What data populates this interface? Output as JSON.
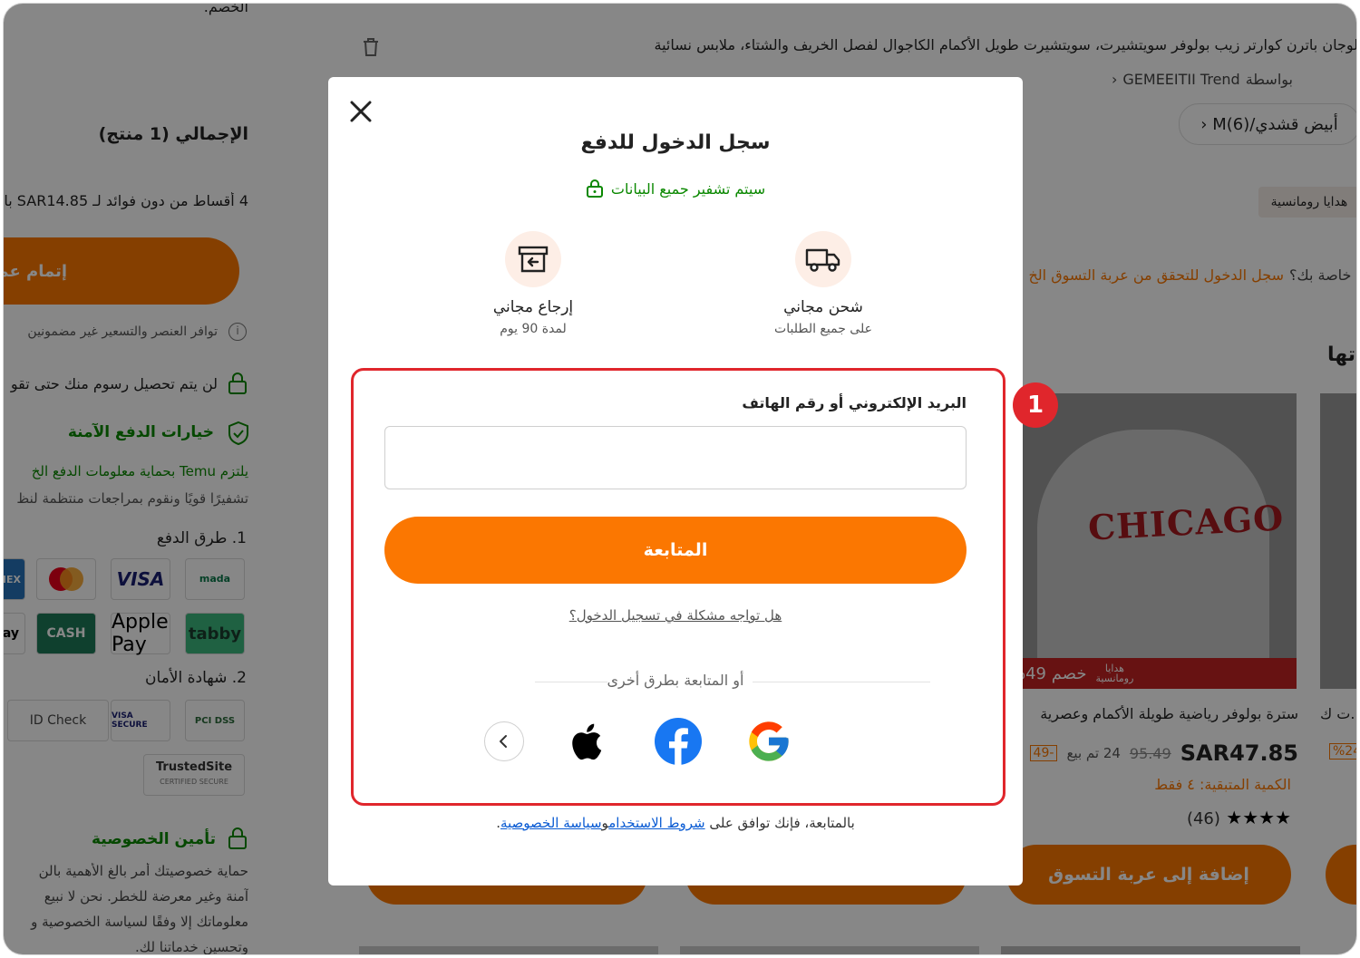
{
  "background": {
    "left_column": {
      "top_text": "الخصم.",
      "total_label": "الإجمالي (1 منتج)",
      "installments": "4 أقساط من دون فوائد لـ SAR14.85 با",
      "checkout_button": "إتمام عم",
      "availability_note": "توافر العنصر والتسعير غير مضمونين",
      "no_fees_note": "لن يتم تحصيل رسوم منك حتى تقو",
      "safe_payment_title": "خيارات الدفع الآمنة",
      "safe_payment_line1": "يلتزم Temu بحماية معلومات الدفع الخ",
      "safe_payment_line2": "تشفيرًا قويًا ونقوم بمراجعات منتظمة لنظ",
      "payment_methods_label": "1. طرق الدفع",
      "payment_methods": [
        "mada",
        "VISA",
        "mastercard",
        "AMEX",
        "tabby",
        "Apple Pay",
        "CASH",
        "Pay"
      ],
      "security_cert_label": "2. شهادة الأمان",
      "security_certs": [
        "PCI DSS",
        "VISA SECURE",
        "ID Check",
        "TrustedSite",
        "CERTIFIED SECURE"
      ],
      "privacy_title": "تأمين الخصوصية",
      "privacy_line1": "حماية خصوصيتك أمر بالغ الأهمية بالن",
      "privacy_line2": "آمنة وغير معرضة للخطر. نحن لا نبيع",
      "privacy_line3": "معلوماتك إلا وفقًا لسياسة الخصوصية و",
      "privacy_line4": "وتحسين خدماتنا لك."
    },
    "product": {
      "title": "لوجان باترن كوارتر زيب بولوفر سويتشيرت، سويتشيرت طويل الأكمام الكاجوال لفصل الخريف والشتاء، ملابس نسائية",
      "seller_prefix": "بواسطة",
      "seller": "GEMEEITII Trend",
      "variant": "أبيض قشدي/M(6)",
      "tag": "هدايا رومانسية",
      "signin_prompt": "سجل الدخول للتحقق من عربة التسوق الخ",
      "signin_prefix": "خاصة بك؟",
      "section_title": "تها"
    },
    "card": {
      "badge_top": "هدايا",
      "badge_bottom": "رومانسية",
      "discount": "خصم 49%",
      "title": "سترة بولوفر رياضية طويلة الأكمام وعصرية",
      "price": "SAR47.85",
      "old_price": "95.49",
      "sold": "24 تم بيع",
      "neg_badge": "-49",
      "remaining": "الكمية المتبقية: ٤ فقط",
      "rating_count": "(46)",
      "stars": "★★★★",
      "add_to_cart": "إضافة إلى عربة التسوق",
      "image_text": "CHICAGO",
      "right_card_title": "...ت ك",
      "right_card_badge": "%24"
    }
  },
  "modal": {
    "title": "سجل الدخول للدفع",
    "secure_note": "سيتم تشفير جميع البيانات",
    "benefits": [
      {
        "title": "شحن مجاني",
        "subtitle": "على جميع الطلبات",
        "icon": "truck-icon"
      },
      {
        "title": "إرجاع مجاني",
        "subtitle": "لمدة 90 يوم",
        "icon": "return-box-icon"
      }
    ],
    "field_label": "البريد الإلكتروني أو رقم الهاتف",
    "field_value": "",
    "field_placeholder": "",
    "continue_label": "المتابعة",
    "trouble_link": "هل تواجه مشكلة في تسجيل الدخول؟",
    "or_text": "أو المتابعة بطرق أخرى",
    "social": [
      "google-icon",
      "facebook-icon",
      "apple-icon"
    ],
    "terms_prefix": "بالمتابعة، فإنك توافق على",
    "terms_link": "شروط الاستخدام",
    "terms_and": "و",
    "privacy_link": "سياسة الخصوصية",
    "terms_suffix": "."
  },
  "annotation": {
    "step_number": "1",
    "color": "#e0262c"
  },
  "colors": {
    "accent": "#fb7701",
    "secure_green": "#0a8800",
    "link_blue": "#0a5bd3"
  }
}
